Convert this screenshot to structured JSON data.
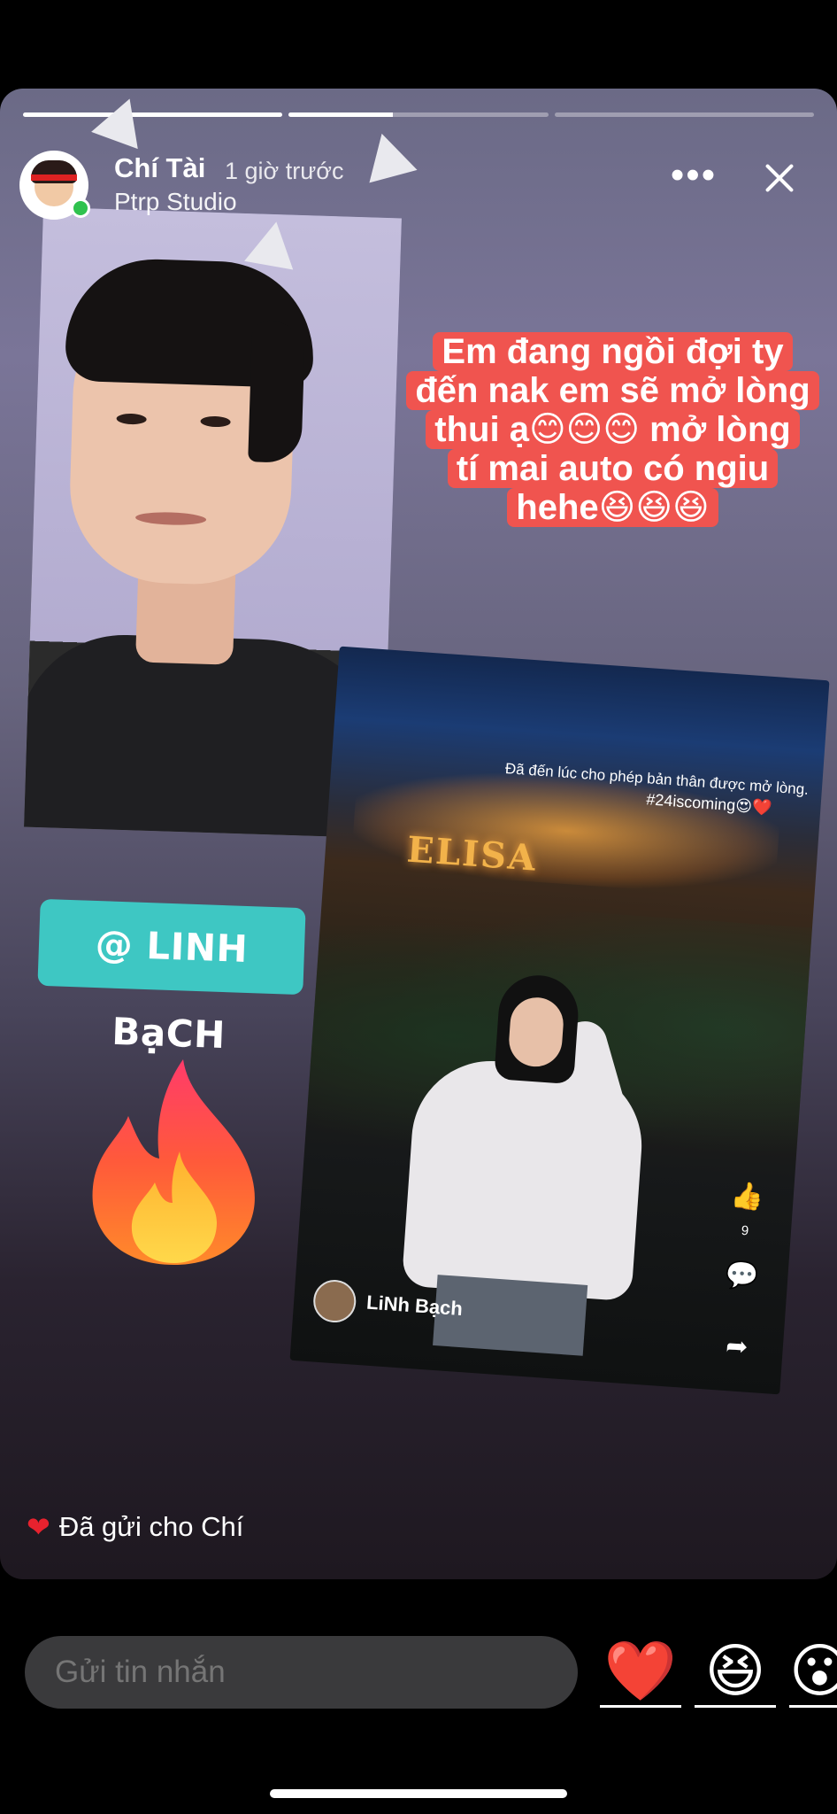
{
  "story": {
    "progress": [
      1.0,
      0.4,
      0.0
    ],
    "user": {
      "name": "Chí Tài",
      "time": "1 giờ trước",
      "subtitle": "Ptrp Studio"
    },
    "more_label": "•••",
    "caption_lines": [
      "Em đang ngồi đợi ty",
      "đến nak em sẽ mở lòng",
      "thui ạ😊😊😊 mở lòng",
      "tí mai auto có ngiu",
      "hehe😆😆😆"
    ],
    "mention": "@ LINH BạCH",
    "sticker_icon": "fire-sticker",
    "shared_post": {
      "sign": "ELISA",
      "text_line1": "Đã đến lúc cho phép bản thân được mở lòng.",
      "text_line2": "#24iscoming😍❤️",
      "author": "LiNh Bạch",
      "like_count": "9"
    },
    "sent_notice": "Đã gửi cho Chí"
  },
  "composer": {
    "placeholder": "Gửi tin nhắn",
    "reactions": [
      "❤️",
      "😆",
      "😮"
    ]
  },
  "colors": {
    "caption_bg": "#f0544f",
    "mention_bg": "#3ec7c3",
    "online": "#2fc24e",
    "input_bg": "#3a3a3c"
  }
}
